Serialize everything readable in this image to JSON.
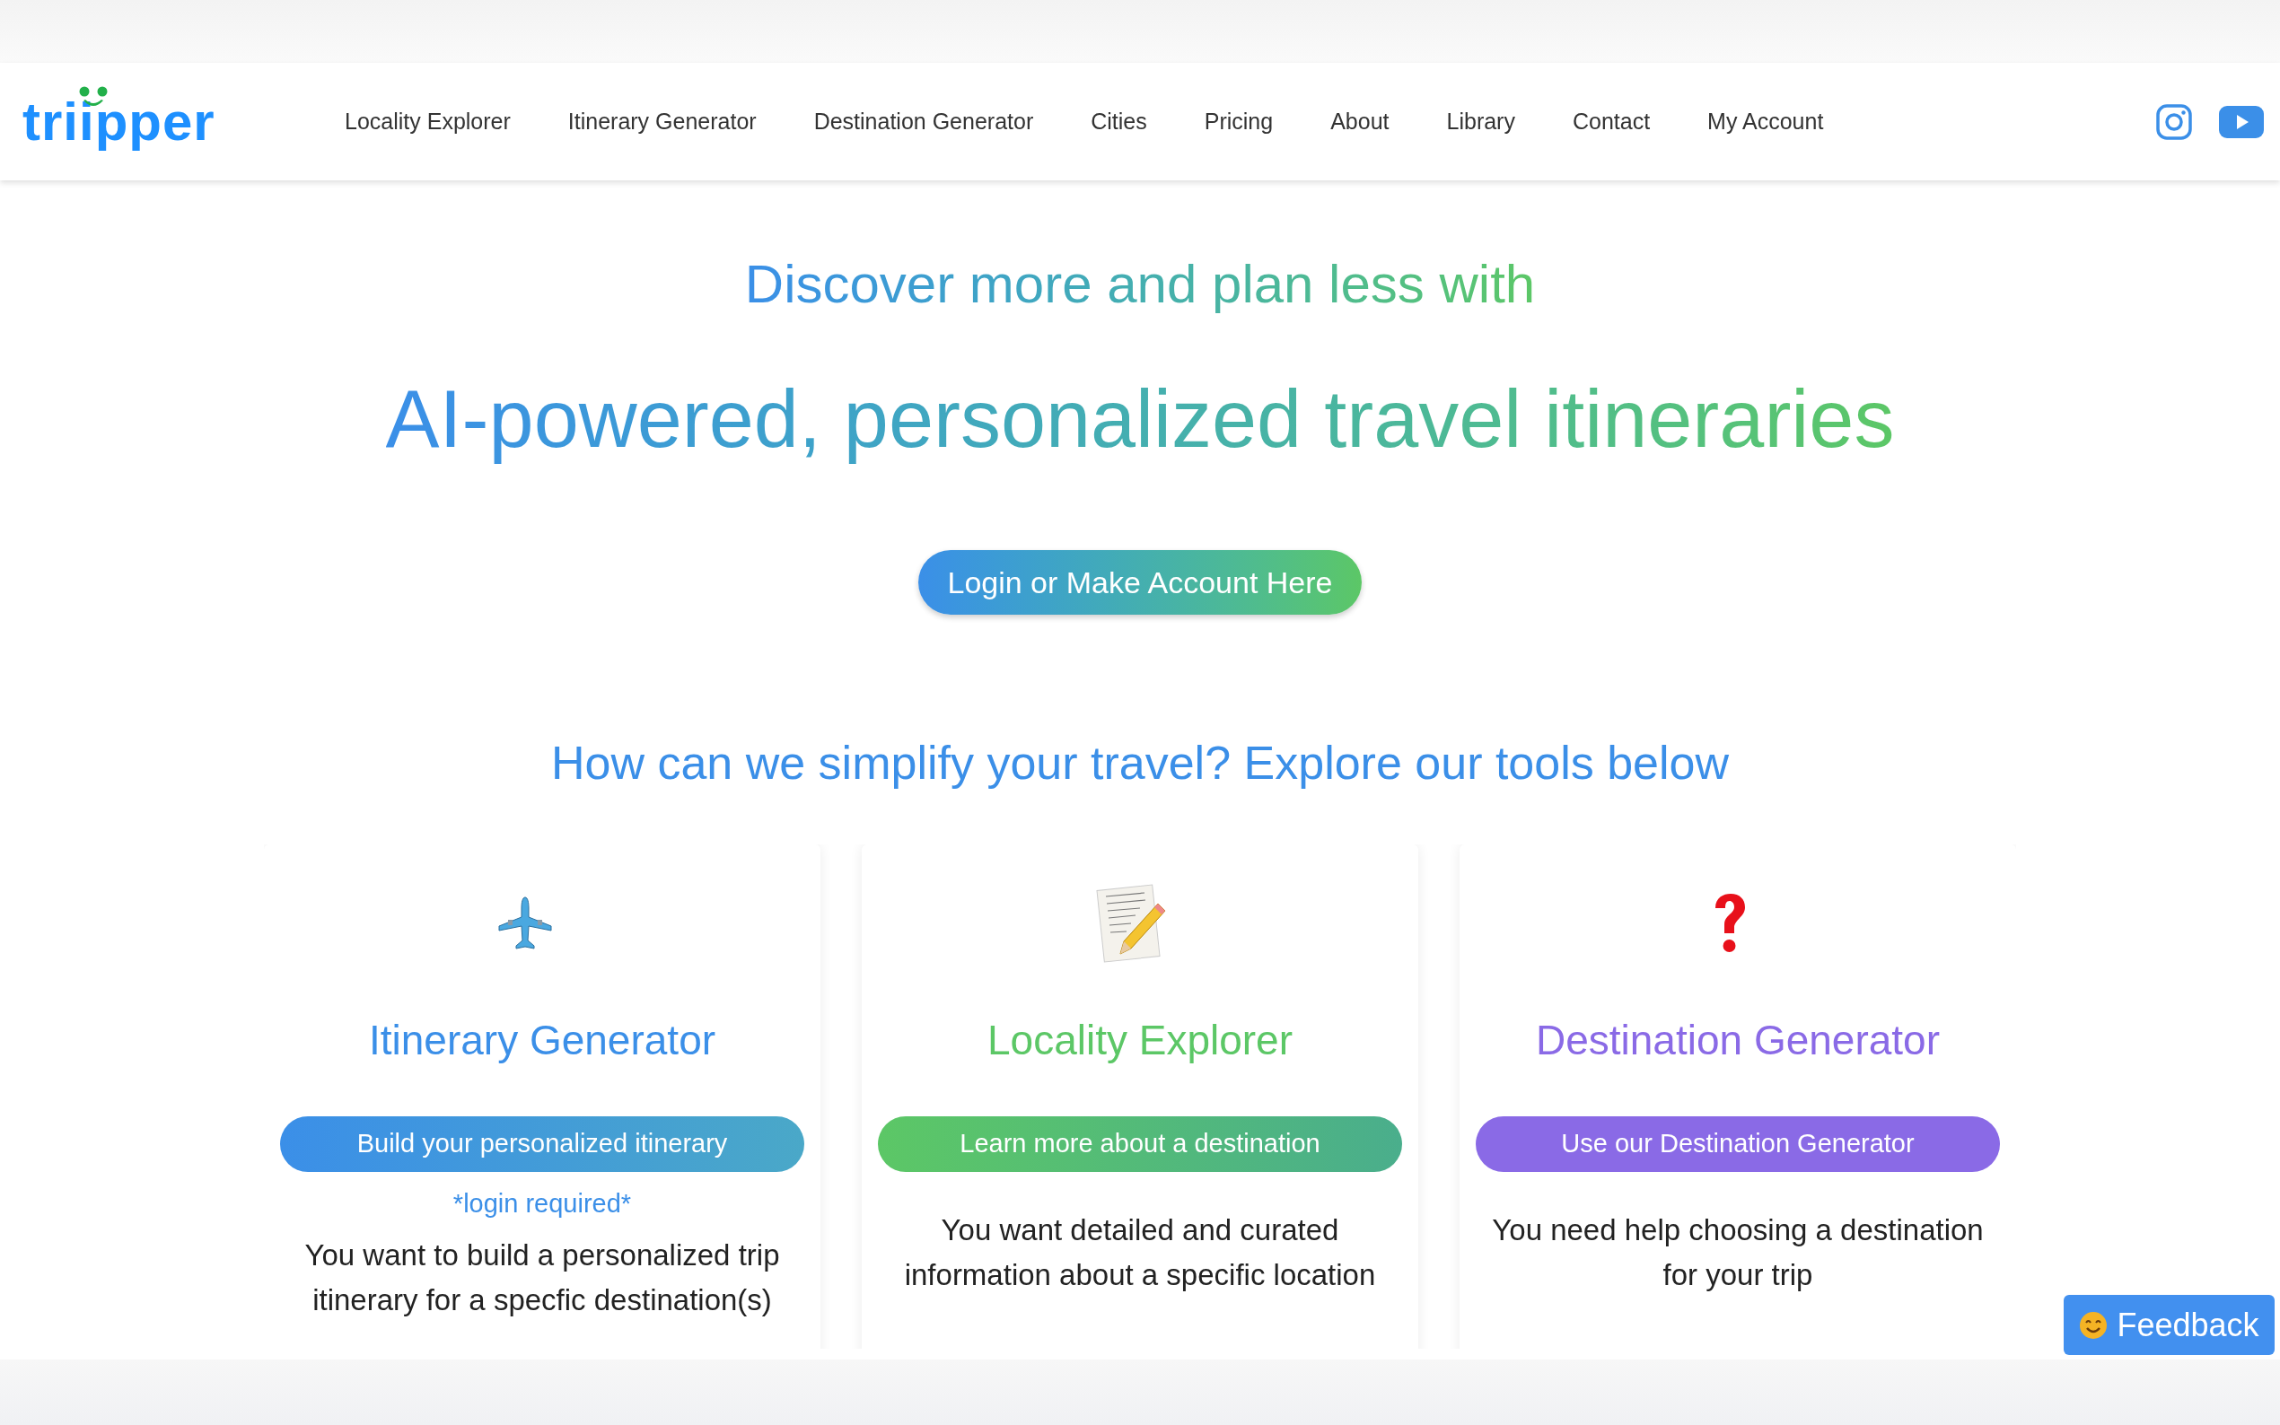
{
  "header": {
    "logo": "triipper",
    "nav": [
      {
        "label": "Locality Explorer"
      },
      {
        "label": "Itinerary Generator"
      },
      {
        "label": "Destination Generator"
      },
      {
        "label": "Cities"
      },
      {
        "label": "Pricing"
      },
      {
        "label": "About"
      },
      {
        "label": "Library"
      },
      {
        "label": "Contact"
      },
      {
        "label": "My Account"
      }
    ],
    "social": [
      {
        "kind": "instagram"
      },
      {
        "kind": "youtube"
      }
    ]
  },
  "hero": {
    "tagline": "Discover more and plan less with",
    "headline": "AI-powered, personalized travel itineraries",
    "button": "Login or Make Account Here"
  },
  "tools_heading": "How can we simplify your travel? Explore our tools below",
  "cards": [
    {
      "kind": "plane",
      "title": "Itinerary Generator",
      "color": "#3b8fe8",
      "button": "Build your personalized itinerary",
      "note": "*login required*",
      "description": "You want to build a personalized trip itinerary for a specfic destination(s)"
    },
    {
      "kind": "note",
      "title": "Locality Explorer",
      "color": "#5cc766",
      "button": "Learn more about a destination",
      "description": "You want detailed and curated information about a specific location"
    },
    {
      "kind": "question",
      "title": "Destination Generator",
      "color": "#8a6ae6",
      "button": "Use our Destination Generator",
      "description": "You need help choosing a destination for your trip"
    }
  ],
  "feedback": "Feedback"
}
